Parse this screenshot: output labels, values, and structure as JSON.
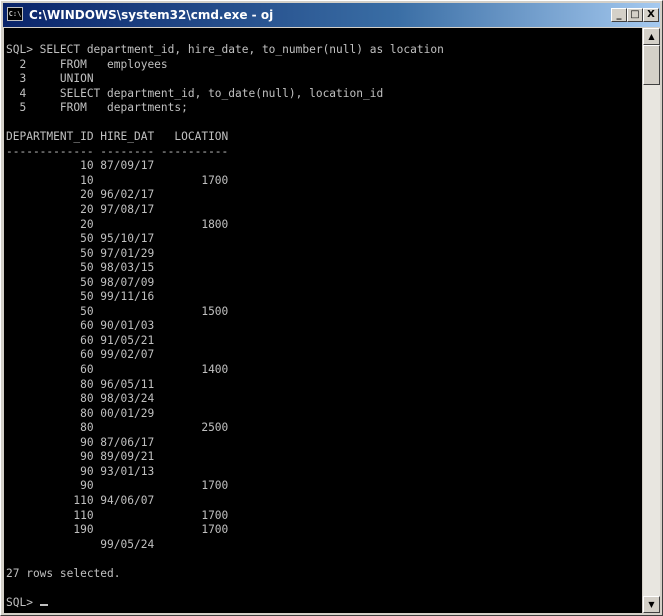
{
  "window": {
    "title": "C:\\WINDOWS\\system32\\cmd.exe - oj",
    "minimize_glyph": "_",
    "maximize_glyph": "□",
    "close_glyph": "X",
    "icon_text": "C:\\"
  },
  "console": {
    "lines": [
      "SQL> SELECT department_id, hire_date, to_number(null) as location",
      "  2     FROM   employees",
      "  3     UNION",
      "  4     SELECT department_id, to_date(null), location_id",
      "  5     FROM   departments;",
      "",
      "DEPARTMENT_ID HIRE_DAT   LOCATION",
      "------------- -------- ----------",
      "           10 87/09/17",
      "           10                1700",
      "           20 96/02/17",
      "           20 97/08/17",
      "           20                1800",
      "           50 95/10/17",
      "           50 97/01/29",
      "           50 98/03/15",
      "           50 98/07/09",
      "           50 99/11/16",
      "           50                1500",
      "           60 90/01/03",
      "           60 91/05/21",
      "           60 99/02/07",
      "           60                1400",
      "           80 96/05/11",
      "           80 98/03/24",
      "           80 00/01/29",
      "           80                2500",
      "           90 87/06/17",
      "           90 89/09/21",
      "           90 93/01/13",
      "           90                1700",
      "          110 94/06/07",
      "          110                1700",
      "          190                1700",
      "              99/05/24",
      "",
      "27 rows selected.",
      "",
      "SQL> "
    ]
  },
  "scrollbar": {
    "up_glyph": "▲",
    "down_glyph": "▼"
  },
  "icons": [
    "console-app-icon",
    "minimize-icon",
    "maximize-icon",
    "close-icon",
    "scroll-up-arrow-icon",
    "scroll-down-arrow-icon"
  ]
}
